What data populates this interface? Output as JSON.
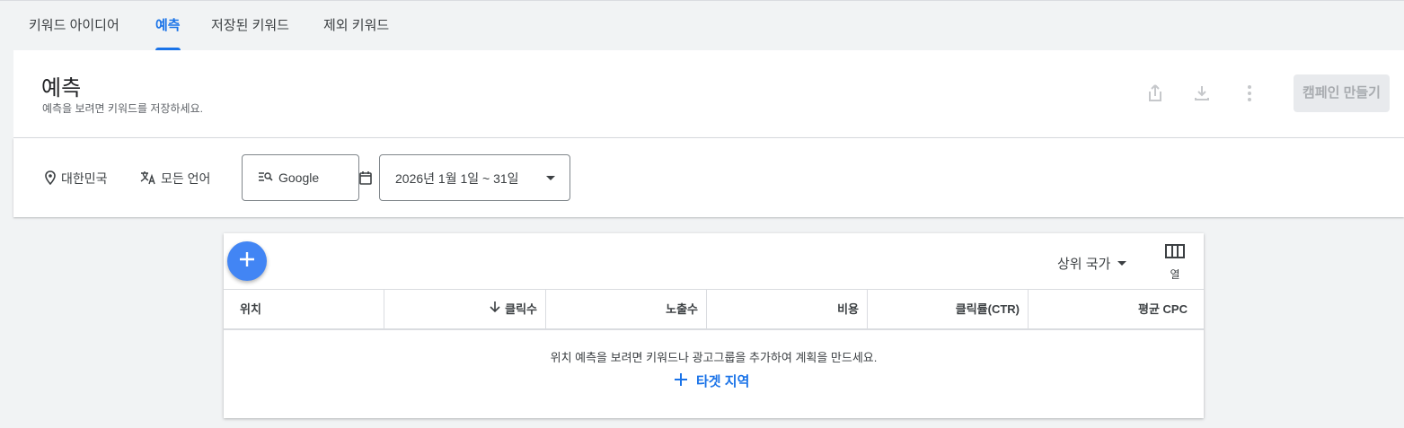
{
  "tabs": [
    {
      "label": "키워드 아이디어"
    },
    {
      "label": "예측"
    },
    {
      "label": "저장된 키워드"
    },
    {
      "label": "제외 키워드"
    }
  ],
  "header": {
    "title": "예측",
    "subtitle": "예측을 보려면 키워드를 저장하세요.",
    "create_campaign_label": "캠페인 만들기",
    "icons": [
      "share-icon",
      "download-icon",
      "more-vert-icon"
    ]
  },
  "filters": {
    "location": "대한민국",
    "language": "모든 언어",
    "network": "Google",
    "date_range": "2026년 1월 1일 ~ 31일"
  },
  "table": {
    "segment_label": "상위 국가",
    "columns_label": "열",
    "headers": [
      "위치",
      "클릭수",
      "노출수",
      "비용",
      "클릭률(CTR)",
      "평균 CPC"
    ],
    "sorted_column": "클릭수",
    "empty_message": "위치 예측을 보려면 키워드나 광고그룹을 추가하여 계획을 만드세요.",
    "add_target_label": "타겟 지역"
  },
  "colors": {
    "accent": "#1a73e8",
    "fab": "#4285f4",
    "background": "#f1f3f4"
  }
}
